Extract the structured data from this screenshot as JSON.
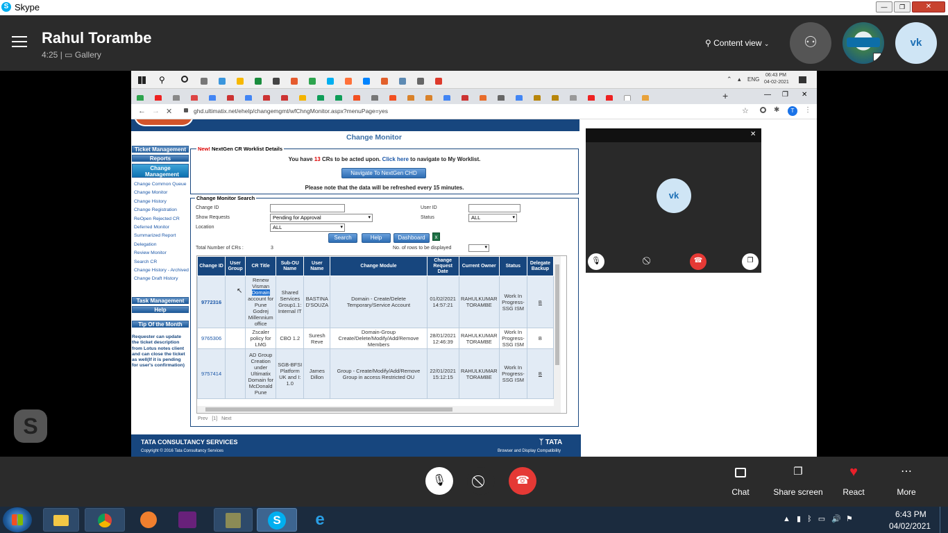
{
  "app": {
    "title": "Skype"
  },
  "window_controls": [
    "—",
    "❐",
    "✕"
  ],
  "header": {
    "caller_name": "Rahul Torambe",
    "call_duration": "4:25",
    "separator": "|",
    "view_mode": "Gallery",
    "content_view_label": "Content view",
    "participant_initials": "vk"
  },
  "remote": {
    "taskbar_lang": "ENG",
    "clock_time": "06:43 PM",
    "clock_date": "04-02-2021",
    "url": "ghd.ultimatix.net/ehelp/changemgmt/wfChngMonitor.aspx?menuPage=yes",
    "profile_initial": "T",
    "page_title": "Change Monitor",
    "left_nav": {
      "ticket_management": "Ticket Management",
      "reports": "Reports",
      "change_management": "Change Management",
      "links": [
        "Change Common Queue",
        "Change Monitor",
        "Change History",
        "Change Registration",
        "ReOpen Rejected CR",
        "Deferred Monitor",
        "Summarized Report",
        "Delegation",
        "Review Monitor",
        "Search CR",
        "Change History - Archived",
        "Change Draft History"
      ],
      "task_management": "Task Management",
      "help": "Help",
      "tip_title": "Tip Of the Month",
      "tip_text": "Requester can update the ticket description from Lotus notes client and can close the ticket as well(If it is pending for user's confirmation)"
    },
    "worklist": {
      "new_label": "New!",
      "title": "NextGen CR Worklist Details",
      "msg_prefix": "You have",
      "count": "13",
      "msg_mid": "CRs to be acted upon.",
      "click_here": "Click here",
      "msg_suffix": "to navigate to My Worklist.",
      "nav_button": "Navigate To NextGen CHD",
      "refresh_note": "Please note that the data will be refreshed every 15 minutes."
    },
    "search": {
      "legend": "Change Monitor Search",
      "change_id_label": "Change ID",
      "change_id_value": "",
      "user_id_label": "User ID",
      "user_id_value": "",
      "show_requests_label": "Show Requests",
      "show_requests_value": "Pending for Approval",
      "status_label": "Status",
      "status_value": "ALL",
      "location_label": "Location",
      "location_value": "ALL",
      "search_btn": "Search",
      "help_btn": "Help",
      "dashboard_btn": "Dashboard",
      "total_label": "Total Number of CRs :",
      "total_value": "3",
      "rows_label": "No. of rows to be displayed",
      "rows_value": ""
    },
    "table": {
      "headers": [
        "Change ID",
        "User Group",
        "CR Title",
        "Sub-OU Name",
        "User Name",
        "Change Module",
        "Change Request Date",
        "Current Owner",
        "Status",
        "Delegate Backup"
      ],
      "rows": [
        {
          "id": "9772316",
          "group": "",
          "title_pre": "Renew Visman",
          "title_hl": "Domain",
          "title_post": "account for Pune Godrej Millennium office",
          "subou": "Shared Services Group1.1: Internal IT",
          "user": "BASTINA D'SOUZA",
          "module": "Domain - Create/Delete Temporary/Service Account",
          "date": "01/02/2021 14:57:21",
          "owner": "RAHULKUMAR TORAMBE",
          "status": "Work In Progress-SSG ISM",
          "delegate": "B"
        },
        {
          "id": "9765306",
          "group": "",
          "title_pre": "Zscaler policy for LMG",
          "title_hl": "",
          "title_post": "",
          "subou": "CBO 1.2",
          "user": "Suresh Reve",
          "module": "Domain-Group Create/Delete/Modify/Add/Remove Members",
          "date": "28/01/2021 12:46:39",
          "owner": "RAHULKUMAR TORAMBE",
          "status": "Work In Progress-SSG ISM",
          "delegate": "B"
        },
        {
          "id": "9757414",
          "group": "",
          "title_pre": "AD Group Creation under Ultimatix Domain for McDonald Pune",
          "title_hl": "",
          "title_post": "",
          "subou": "SGB-BFSI Platform UK and I: 1.0",
          "user": "James Dillon",
          "module": "Group - Create/Modify/Add/Remove Group in access Restricted OU",
          "date": "22/01/2021 15:12:15",
          "owner": "RAHULKUMAR TORAMBE",
          "status": "Work In Progress-SSG ISM",
          "delegate": "B"
        }
      ]
    },
    "pager": {
      "prev": "Prev",
      "page": "[1]",
      "next": "Next"
    },
    "footer": {
      "company": "TATA CONSULTANCY SERVICES",
      "copyright": "Copyright © 2016 Tata Consultancy Services",
      "brand": "TATA",
      "compat": "Browser and Display Compatibility"
    }
  },
  "self_video": {
    "initials": "vk"
  },
  "controls": {
    "chat": "Chat",
    "share_screen": "Share screen",
    "react": "React",
    "more": "More"
  },
  "taskbar": {
    "time": "6:43 PM",
    "date": "04/02/2021"
  },
  "colors": {
    "skype_dark": "#2b2b2b",
    "end_call": "#e53935",
    "tcs_blue": "#17467e",
    "react_red": "#e8202a"
  }
}
